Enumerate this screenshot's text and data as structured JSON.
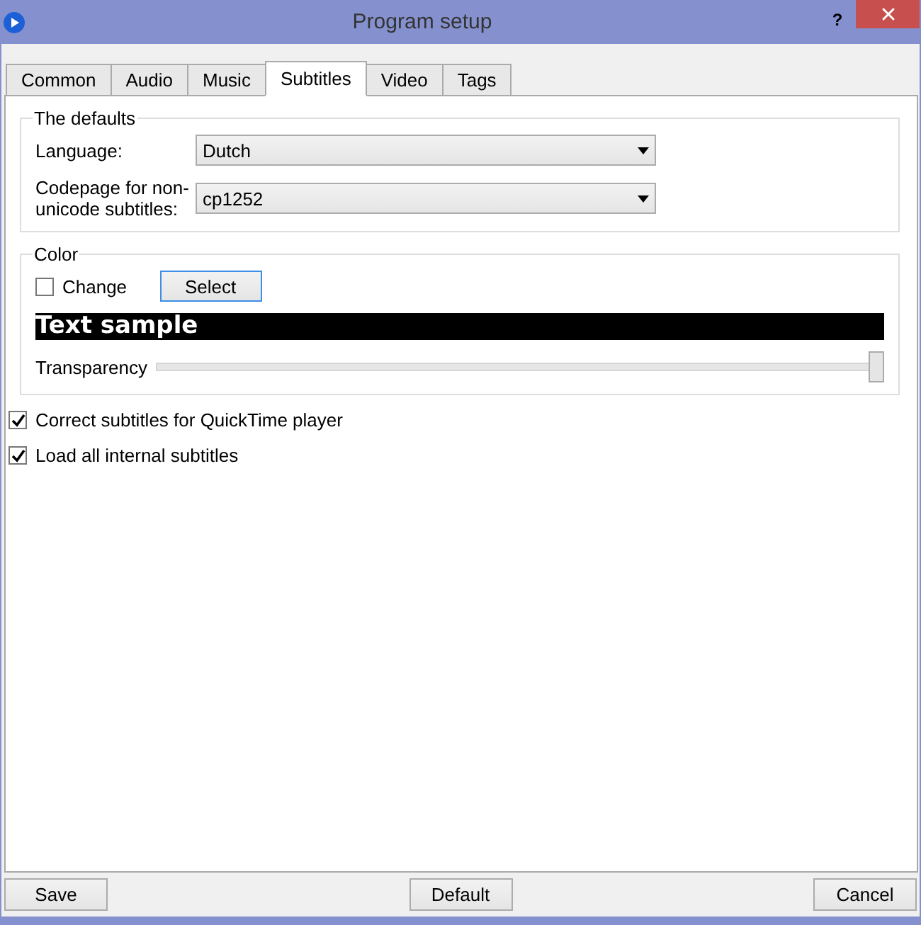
{
  "window": {
    "title": "Program setup",
    "help": "?"
  },
  "tabs": [
    {
      "label": "Common",
      "selected": false
    },
    {
      "label": "Audio",
      "selected": false
    },
    {
      "label": "Music",
      "selected": false
    },
    {
      "label": "Subtitles",
      "selected": true
    },
    {
      "label": "Video",
      "selected": false
    },
    {
      "label": "Tags",
      "selected": false
    }
  ],
  "defaults": {
    "title": "The defaults",
    "fields": [
      {
        "label": "Language:",
        "value": "Dutch"
      },
      {
        "label": "Codepage for non-unicode subtitles:",
        "value": "cp1252"
      }
    ]
  },
  "color": {
    "title": "Color",
    "change": {
      "label": "Change",
      "checked": false
    },
    "select_button": "Select",
    "sample": "Text sample",
    "transparency": {
      "label": "Transparency",
      "level": 1.0
    }
  },
  "options": [
    {
      "label": "Correct subtitles for QuickTime player",
      "checked": true
    },
    {
      "label": "Load all internal subtitles",
      "checked": true
    }
  ],
  "buttons": {
    "save": "Save",
    "default": "Default",
    "cancel": "Cancel"
  }
}
